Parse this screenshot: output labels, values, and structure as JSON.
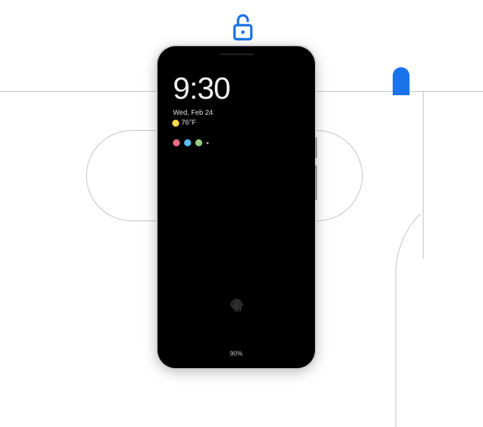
{
  "lockscreen": {
    "time": "9:30",
    "date": "Wed, Feb 24",
    "temperature": "76°F",
    "battery": "90%"
  },
  "colors": {
    "accent_blue": "#1a73e8"
  }
}
